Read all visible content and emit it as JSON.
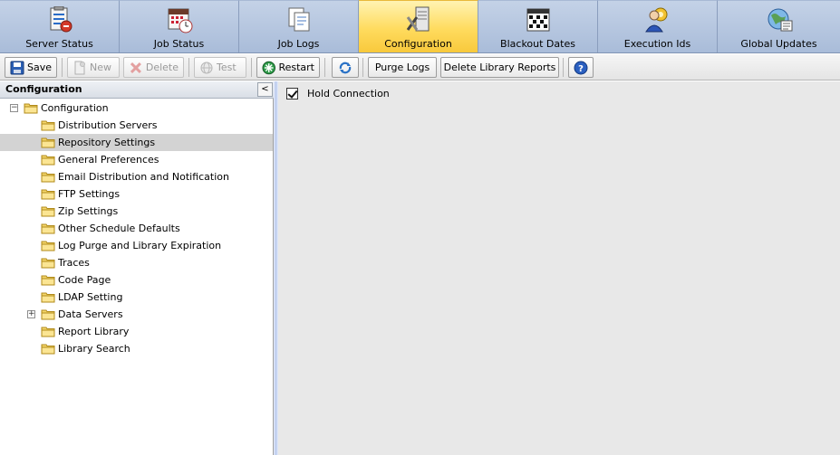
{
  "tabs": [
    {
      "label": "Server Status",
      "icon": "server-status-icon",
      "active": false
    },
    {
      "label": "Job Status",
      "icon": "job-status-icon",
      "active": false
    },
    {
      "label": "Job Logs",
      "icon": "job-logs-icon",
      "active": false
    },
    {
      "label": "Configuration",
      "icon": "configuration-icon",
      "active": true
    },
    {
      "label": "Blackout Dates",
      "icon": "blackout-dates-icon",
      "active": false
    },
    {
      "label": "Execution Ids",
      "icon": "execution-ids-icon",
      "active": false
    },
    {
      "label": "Global Updates",
      "icon": "global-updates-icon",
      "active": false
    }
  ],
  "toolbar": {
    "save": "Save",
    "new": "New",
    "delete": "Delete",
    "test": "Test",
    "restart": "Restart",
    "purge_logs": "Purge Logs",
    "delete_library_reports": "Delete Library Reports"
  },
  "left_pane": {
    "title": "Configuration",
    "collapse_glyph": "<",
    "tree": {
      "root": "Configuration",
      "children": [
        "Distribution Servers",
        "Repository Settings",
        "General Preferences",
        "Email Distribution and Notification",
        "FTP Settings",
        "Zip Settings",
        "Other Schedule Defaults",
        "Log Purge and Library Expiration",
        "Traces",
        "Code Page",
        "LDAP Setting",
        "Data Servers",
        "Report Library",
        "Library Search"
      ],
      "selected": "Repository Settings",
      "expandable": "Data Servers"
    }
  },
  "right_pane": {
    "hold_connection_label": "Hold Connection",
    "hold_connection_checked": true
  },
  "colors": {
    "tab_active": "#ffdb5e",
    "tab_inactive": "#b4c5df",
    "selection": "#d3d3d3",
    "content_bg": "#e8e8e8"
  }
}
